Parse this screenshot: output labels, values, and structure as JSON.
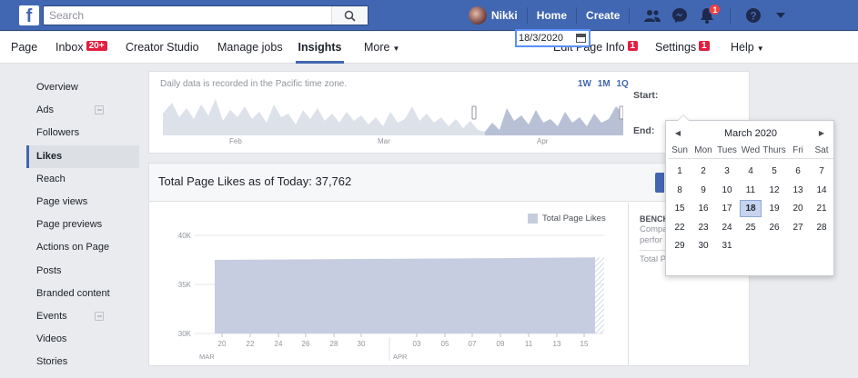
{
  "topbar": {
    "search_placeholder": "Search",
    "user_name": "Nikki",
    "home": "Home",
    "create": "Create",
    "notif_count": "1"
  },
  "pagebar": {
    "tabs": [
      {
        "label": "Page"
      },
      {
        "label": "Inbox",
        "badge": "20+"
      },
      {
        "label": "Creator Studio"
      },
      {
        "label": "Manage jobs"
      },
      {
        "label": "Insights"
      },
      {
        "label": "More"
      }
    ],
    "right": [
      {
        "label": "Edit Page Info",
        "badge": "1"
      },
      {
        "label": "Settings",
        "badge": "1"
      },
      {
        "label": "Help"
      }
    ]
  },
  "sidebar": {
    "items": [
      {
        "label": "Overview"
      },
      {
        "label": "Ads"
      },
      {
        "label": "Followers"
      },
      {
        "label": "Likes"
      },
      {
        "label": "Reach"
      },
      {
        "label": "Page views"
      },
      {
        "label": "Page previews"
      },
      {
        "label": "Actions on Page"
      },
      {
        "label": "Posts"
      },
      {
        "label": "Branded content"
      },
      {
        "label": "Events"
      },
      {
        "label": "Videos"
      },
      {
        "label": "Stories"
      }
    ]
  },
  "range": {
    "pacific_note": "Daily data is recorded in the Pacific time zone.",
    "buttons": [
      "1W",
      "1M",
      "1Q"
    ],
    "months": [
      "Feb",
      "Mar",
      "Apr"
    ],
    "start_label": "Start:",
    "end_label": "End:",
    "start_value": "18/3/2020"
  },
  "main": {
    "total_title": "Total Page Likes as of Today: 37,762",
    "legend_label": "Total Page Likes",
    "bench_title": "BENCH",
    "bench_desc_1": "Compa",
    "bench_desc_2": "perfor",
    "bench_total": "Total P"
  },
  "chart_data": {
    "type": "area",
    "title": "",
    "ylabel": "",
    "xlabel": "",
    "ylim": [
      30000,
      40000
    ],
    "yticks": [
      "40K",
      "35K",
      "30K"
    ],
    "xtick_labels": [
      "20",
      "22",
      "24",
      "26",
      "28",
      "30",
      "03",
      "05",
      "07",
      "09",
      "11",
      "13",
      "15"
    ],
    "month_labels": [
      "MAR",
      "APR"
    ],
    "series": [
      {
        "name": "Total Page Likes",
        "values": [
          37500,
          37520,
          37540,
          37560,
          37580,
          37600,
          37620,
          37640,
          37660,
          37680,
          37700,
          37730,
          37762
        ]
      }
    ]
  },
  "picker": {
    "month_title": "March 2020",
    "weekdays": [
      "Sun",
      "Mon",
      "Tues",
      "Wed",
      "Thurs",
      "Fri",
      "Sat"
    ],
    "selected": "18",
    "days": [
      "1",
      "2",
      "3",
      "4",
      "5",
      "6",
      "7",
      "8",
      "9",
      "10",
      "11",
      "12",
      "13",
      "14",
      "15",
      "16",
      "17",
      "18",
      "19",
      "20",
      "21",
      "22",
      "23",
      "24",
      "25",
      "26",
      "27",
      "28",
      "29",
      "30",
      "31"
    ]
  },
  "colors": {
    "brand_blue": "#4267b2",
    "chart_fill": "#c6cde0",
    "badge_red": "#e41e3f"
  }
}
